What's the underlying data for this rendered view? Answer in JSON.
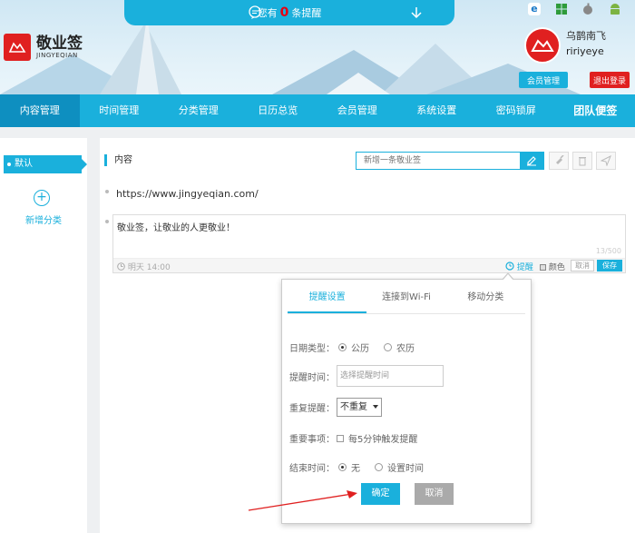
{
  "app": {
    "name_cn": "敬业签",
    "name_en": "JINGYEQIAN"
  },
  "notice": {
    "prefix": "您有",
    "count": "0",
    "suffix": "条提醒"
  },
  "user": {
    "name_cn": "乌鹊南飞",
    "name_en": "ririyeye",
    "member_btn": "会员管理",
    "logout_btn": "退出登录"
  },
  "nav": [
    "内容管理",
    "时间管理",
    "分类管理",
    "日历总览",
    "会员管理",
    "系统设置",
    "密码锁屏",
    "团队便签"
  ],
  "sidebar": {
    "default_label": "默认",
    "add_category": "新增分类"
  },
  "content": {
    "section_title": "内容",
    "search_placeholder": "新增一条敬业签",
    "url_item": "https://www.jingyeqian.com/",
    "editor_text": "敬业签，让敬业的人更敬业！",
    "char_count": "13/500",
    "date_hint": "明天 14:00",
    "remind_label": "提醒",
    "color_label": "颜色",
    "cancel_label": "取消",
    "save_label": "保存"
  },
  "popup": {
    "tabs": [
      "提醒设置",
      "连接到Wi-Fi",
      "移动分类"
    ],
    "date_type_label": "日期类型：",
    "date_opt1": "公历",
    "date_opt2": "农历",
    "remind_time_label": "提醒时间：",
    "remind_time_placeholder": "选择提醒时间",
    "repeat_label": "重复提醒：",
    "repeat_value": "不重复",
    "important_label": "重要事项：",
    "important_opt": "每5分钟触发提醒",
    "end_label": "结束时间：",
    "end_opt1": "无",
    "end_opt2": "设置时间",
    "confirm_label": "确定",
    "cancel_label": "取消"
  },
  "colors": {
    "accent": "#1ab0dc",
    "brand_red": "#e02020",
    "nav_active": "#0e8fc0",
    "member_btn": "#1ab0dc",
    "logout_btn": "#e02020"
  }
}
